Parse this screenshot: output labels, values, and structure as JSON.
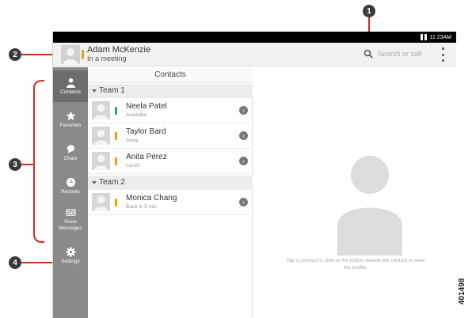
{
  "statusbar": {
    "time": "11:23AM"
  },
  "header": {
    "user_name": "Adam McKenzie",
    "user_status": "In a meeting",
    "search_placeholder": "Search or call",
    "presence_color": "#f39c12"
  },
  "sidebar": {
    "items": [
      {
        "label": "Contacts",
        "icon": "person-icon",
        "active": true
      },
      {
        "label": "Favorites",
        "icon": "star-icon"
      },
      {
        "label": "Chats",
        "icon": "chat-bubble-icon"
      },
      {
        "label": "Recents",
        "icon": "clock-icon"
      },
      {
        "label": "Voice\nMessages",
        "icon": "voicemail-icon"
      },
      {
        "label": "Settings",
        "icon": "gear-icon"
      }
    ]
  },
  "contacts": {
    "title": "Contacts",
    "groups": [
      {
        "name": "Team 1",
        "members": [
          {
            "name": "Neela Patel",
            "status": "Available",
            "presence": "#27ae60"
          },
          {
            "name": "Taylor Bard",
            "status": "Away",
            "presence": "#f39c12"
          },
          {
            "name": "Anita Perez",
            "status": "Lunch",
            "presence": "#f39c12"
          }
        ]
      },
      {
        "name": "Team 2",
        "members": [
          {
            "name": "Monica Chang",
            "status": "Back in 5 min",
            "presence": "#f39c12"
          }
        ]
      }
    ]
  },
  "detail": {
    "hint": "Tap a contact to chat or the button beside the contact to view the profile."
  },
  "callouts": [
    "1",
    "2",
    "3",
    "4"
  ],
  "figure_id": "401498",
  "colors": {
    "callout_line": "#d62a20",
    "sidebar_bg": "#8a8a8a",
    "sidebar_active": "#6d6d6d"
  }
}
